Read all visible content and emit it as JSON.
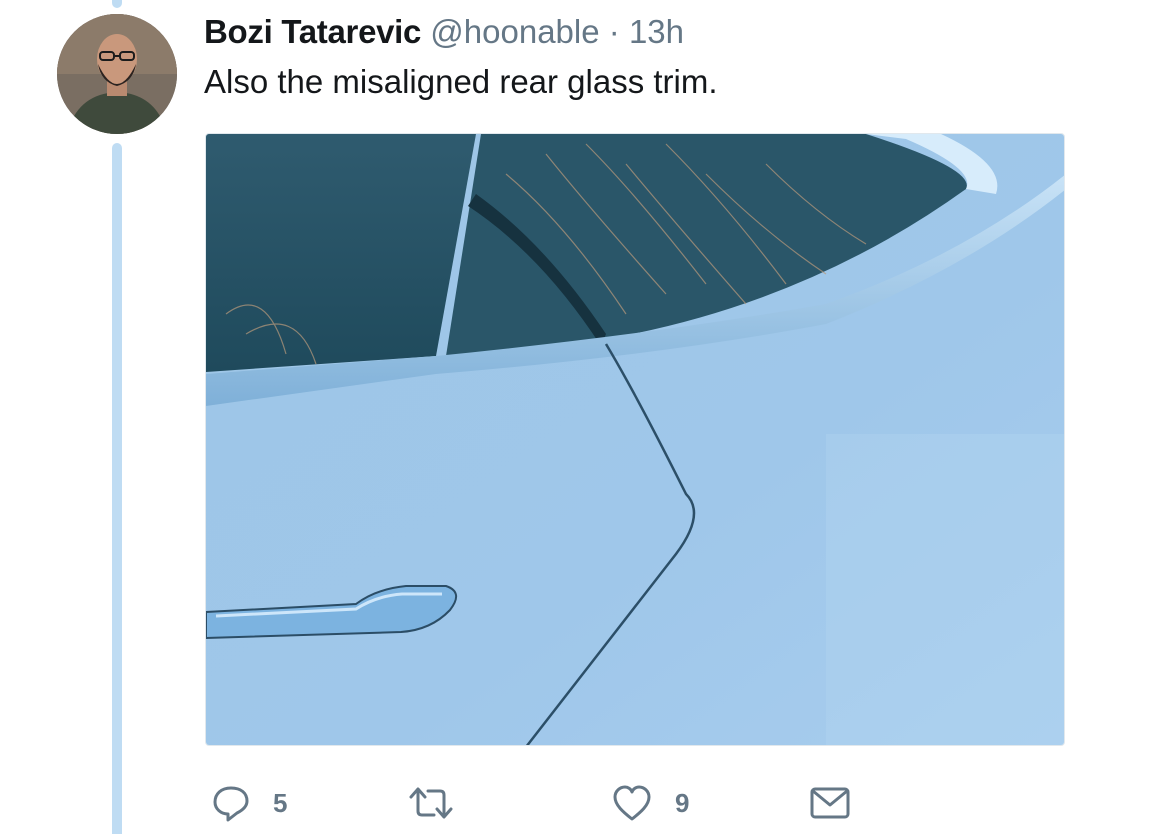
{
  "tweet": {
    "author_name": "Bozi Tatarevic",
    "author_handle": "@hoonable",
    "separator": "·",
    "time": "13h",
    "text": "Also the misaligned rear glass trim."
  },
  "actions": {
    "reply_count": "5",
    "retweet_count": "",
    "like_count": "9"
  },
  "colors": {
    "thread_line": "#bfdcf3",
    "secondary_text": "#657786",
    "primary_text": "#14171a"
  },
  "icons": {
    "reply": "speech-bubble-icon",
    "retweet": "retweet-arrows-icon",
    "like": "heart-icon",
    "dm": "envelope-icon"
  }
}
